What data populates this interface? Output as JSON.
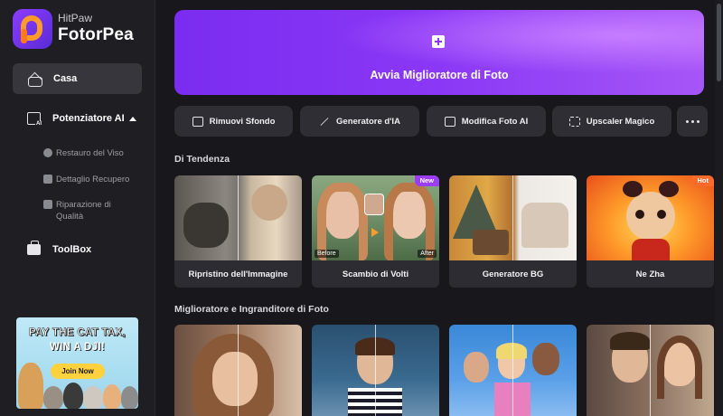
{
  "brand": {
    "top": "HitPaw",
    "name": "FotorPea"
  },
  "sidebar": {
    "home": "Casa",
    "enhancer": "Potenziatore AI",
    "sub": [
      "Restauro del Viso",
      "Dettaglio Recupero",
      "Riparazione di Qualità"
    ],
    "toolbox": "ToolBox"
  },
  "promo": {
    "line1": "PAY THE CAT TAX,",
    "line2": "WIN A DJI!",
    "cta": "Join Now"
  },
  "hero": {
    "label": "Avvia Miglioratore di Foto"
  },
  "tools": [
    "Rimuovi Sfondo",
    "Generatore d'IA",
    "Modifica Foto AI",
    "Upscaler Magico"
  ],
  "sections": {
    "trending": "Di Tendenza",
    "enhancer": "Miglioratore e Ingranditore di Foto"
  },
  "trending": [
    {
      "title": "Ripristino dell'Immagine",
      "tag": ""
    },
    {
      "title": "Scambio di Volti",
      "tag": "New",
      "before": "Before",
      "after": "After"
    },
    {
      "title": "Generatore BG",
      "tag": ""
    },
    {
      "title": "Ne Zha",
      "tag": "Hot"
    }
  ],
  "colors": {
    "accent": "#8a38f5",
    "new_tag": "#9b3df5",
    "hot_tag": "#ff6a2a"
  }
}
